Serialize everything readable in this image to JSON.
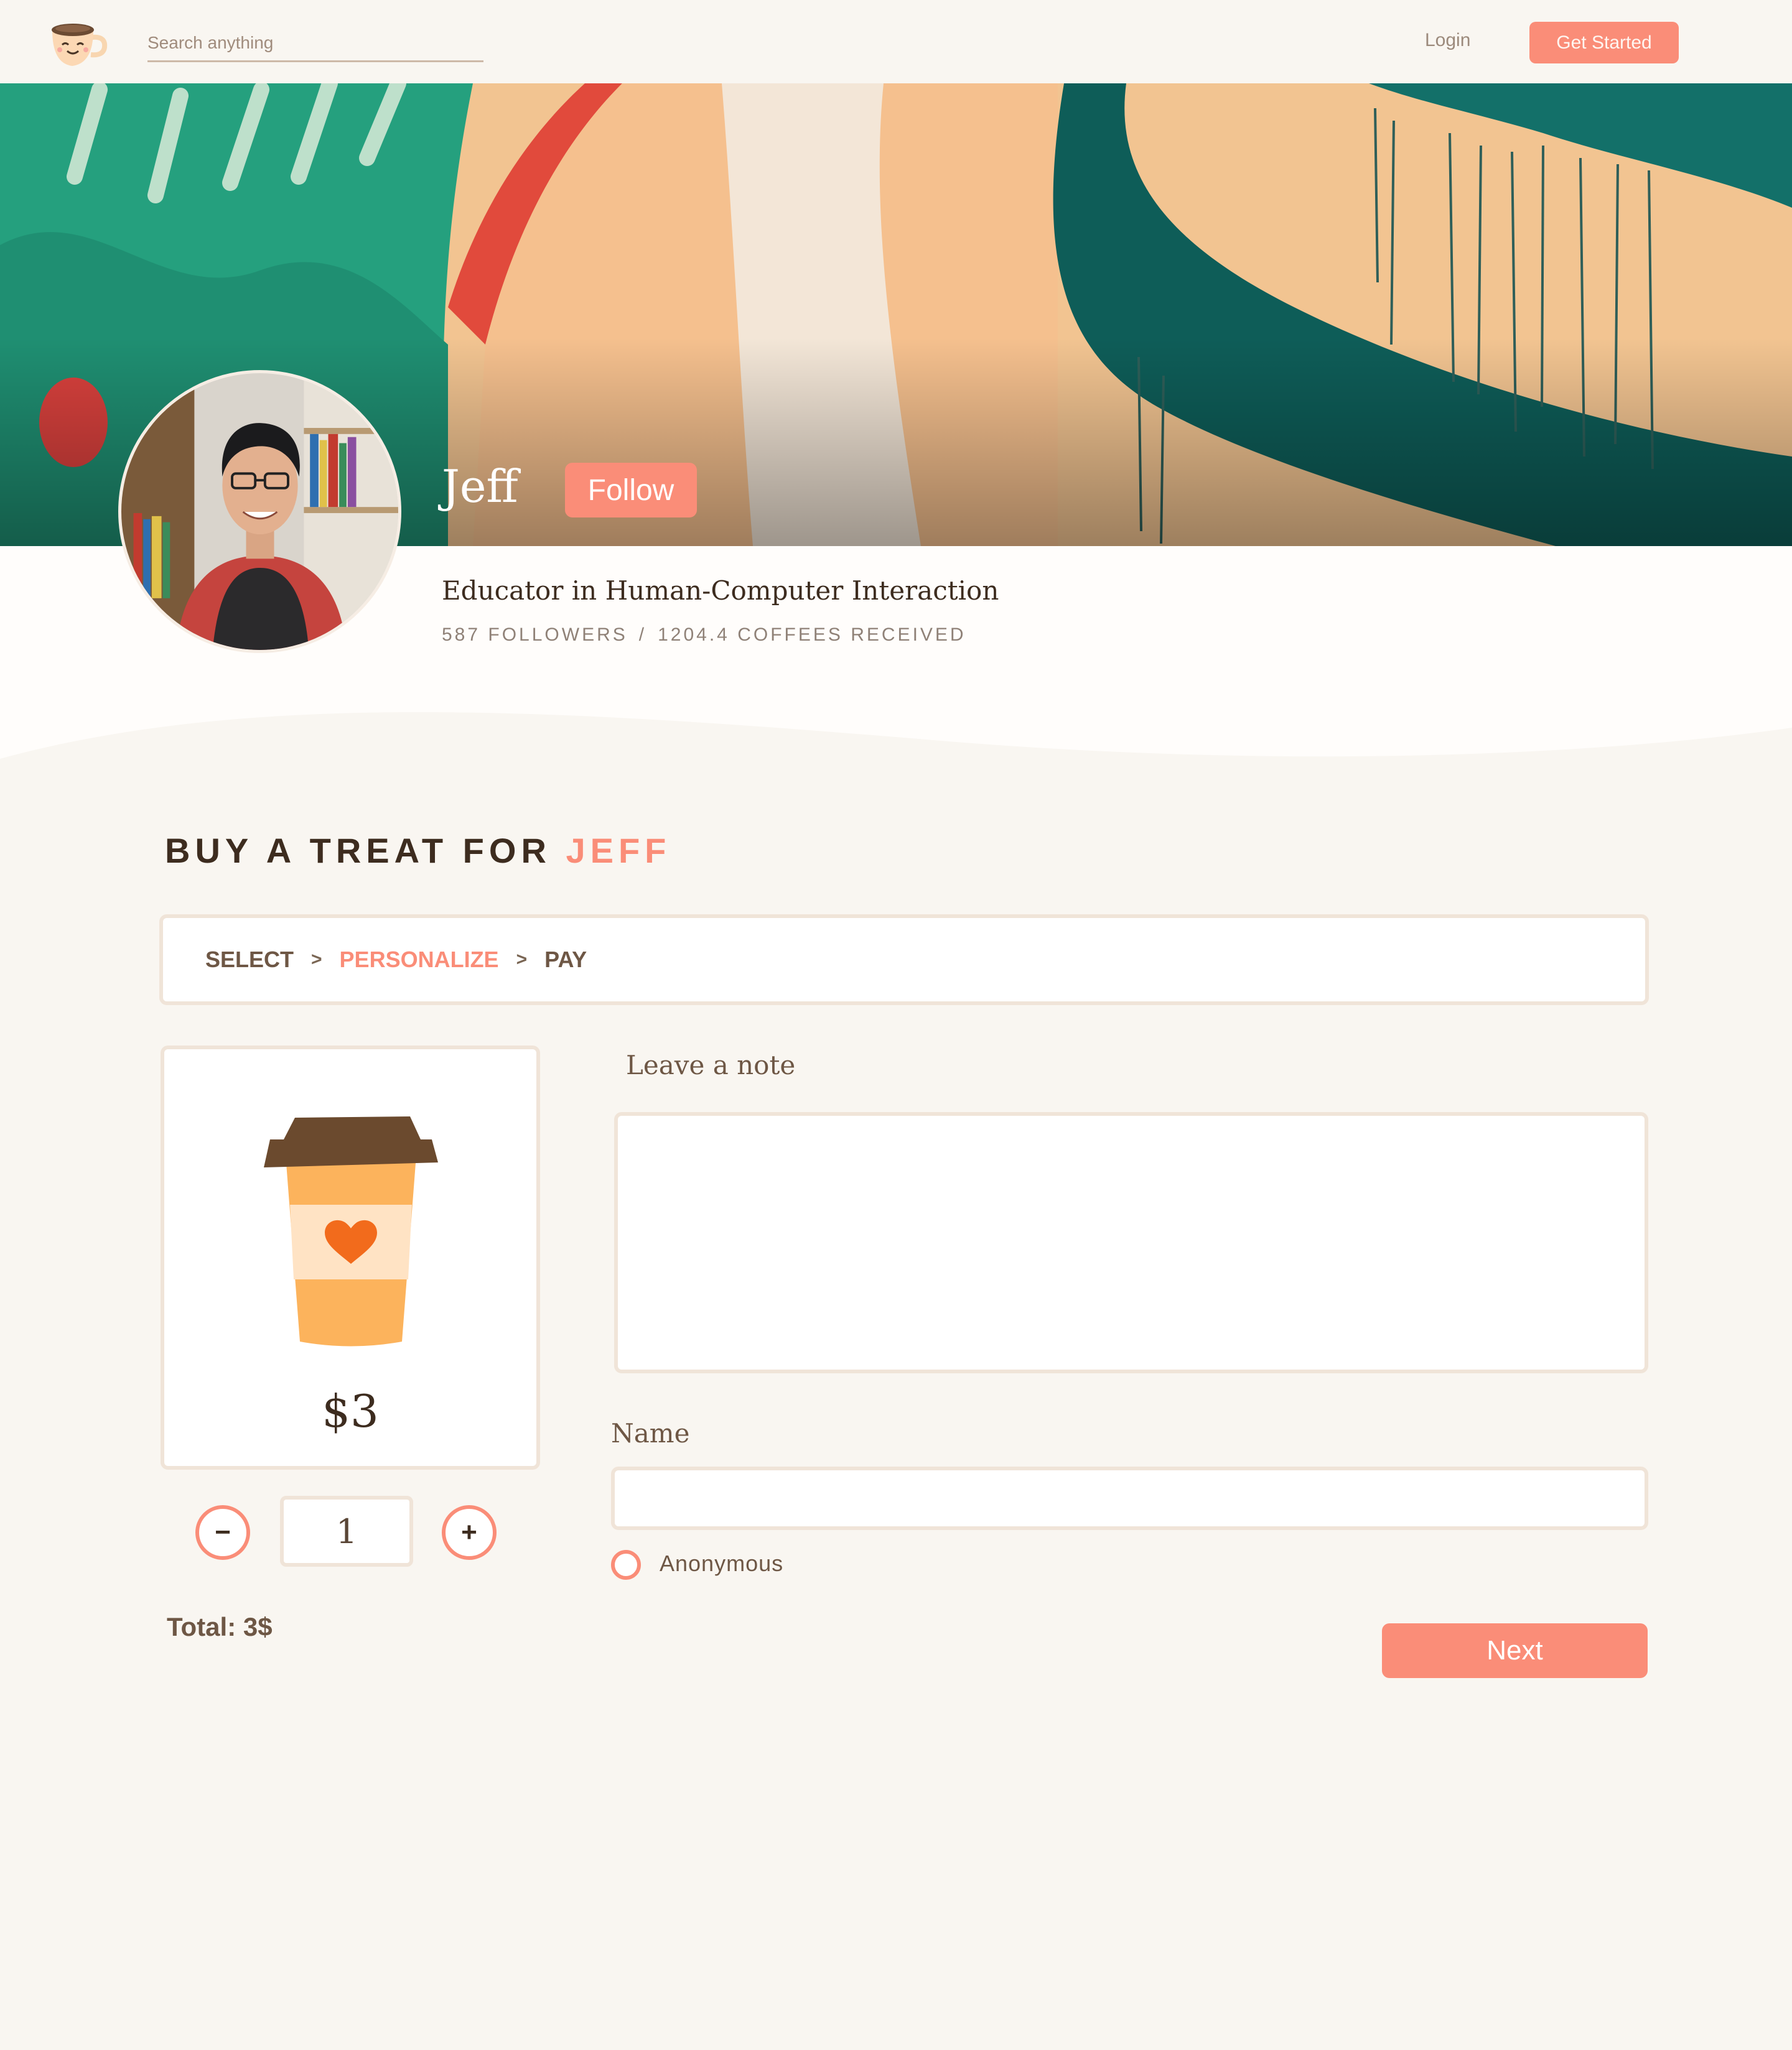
{
  "nav": {
    "search_placeholder": "Search anything",
    "login_label": "Login",
    "get_started_label": "Get Started",
    "logo_icon": "coffee-cup-smile-icon"
  },
  "profile": {
    "name": "Jeff",
    "follow_label": "Follow",
    "bio": "Educator in Human-Computer Interaction",
    "followers": "587 FOLLOWERS",
    "separator": "/",
    "coffees": "1204.4 COFFEES RECEIVED"
  },
  "buy": {
    "title_prefix": "BUY A TREAT FOR",
    "title_name": "JEFF",
    "steps": [
      {
        "label": "SELECT",
        "active": false
      },
      {
        "label": "PERSONALIZE",
        "active": true
      },
      {
        "label": "PAY",
        "active": false
      }
    ],
    "step_separator": ">",
    "price": "$3",
    "minus_label": "−",
    "plus_label": "+",
    "quantity": "1",
    "total": "Total: 3$",
    "note_label": "Leave a note",
    "note_value": "",
    "name_label": "Name",
    "name_value": "",
    "anonymous_label": "Anonymous",
    "next_label": "Next"
  },
  "colors": {
    "accent": "#fa8d78",
    "background": "#f9f6f1",
    "border": "#f0e4d8",
    "text_dark": "#3d2c1f"
  }
}
